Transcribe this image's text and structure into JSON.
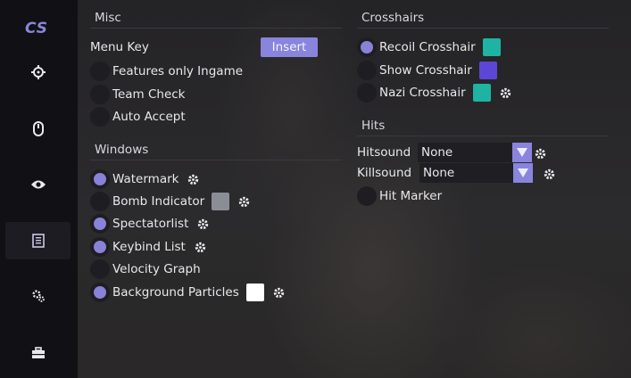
{
  "app": {
    "logo_text": "CS"
  },
  "sidebar": {
    "items": [
      {
        "icon": "crosshair-icon",
        "active": false
      },
      {
        "icon": "mouse-icon",
        "active": false
      },
      {
        "icon": "eye-icon",
        "active": false
      },
      {
        "icon": "document-icon",
        "active": true
      },
      {
        "icon": "gears-icon",
        "active": false
      },
      {
        "icon": "briefcase-icon",
        "active": false
      }
    ]
  },
  "misc": {
    "title": "Misc",
    "menu_key_label": "Menu Key",
    "menu_key_value": "Insert",
    "features_only_ingame": {
      "label": "Features only Ingame",
      "checked": false
    },
    "team_check": {
      "label": "Team Check",
      "checked": false
    },
    "auto_accept": {
      "label": "Auto Accept",
      "checked": false
    }
  },
  "windows": {
    "title": "Windows",
    "watermark": {
      "label": "Watermark",
      "checked": true
    },
    "bomb_indicator": {
      "label": "Bomb Indicator",
      "checked": false,
      "color": "#8b8d96"
    },
    "spectatorlist": {
      "label": "Spectatorlist",
      "checked": true
    },
    "keybind_list": {
      "label": "Keybind List",
      "checked": true
    },
    "velocity_graph": {
      "label": "Velocity Graph",
      "checked": false
    },
    "background_particles": {
      "label": "Background Particles",
      "checked": true,
      "color": "#ffffff"
    }
  },
  "crosshairs": {
    "title": "Crosshairs",
    "recoil_crosshair": {
      "label": "Recoil Crosshair",
      "checked": true,
      "color": "#1fb3a3"
    },
    "show_crosshair": {
      "label": "Show Crosshair",
      "checked": false,
      "color": "#5b47d6"
    },
    "nazi_crosshair": {
      "label": "Nazi Crosshair",
      "checked": false,
      "color": "#1fb3a3"
    }
  },
  "hits": {
    "title": "Hits",
    "hitsound": {
      "label": "Hitsound",
      "value": "None"
    },
    "killsound": {
      "label": "Killsound",
      "value": "None"
    },
    "hit_marker": {
      "label": "Hit Marker",
      "checked": false
    }
  },
  "colors": {
    "accent": "#8984dc",
    "sidebar_bg": "#111014",
    "checkbox_bg": "#1e1d21"
  }
}
